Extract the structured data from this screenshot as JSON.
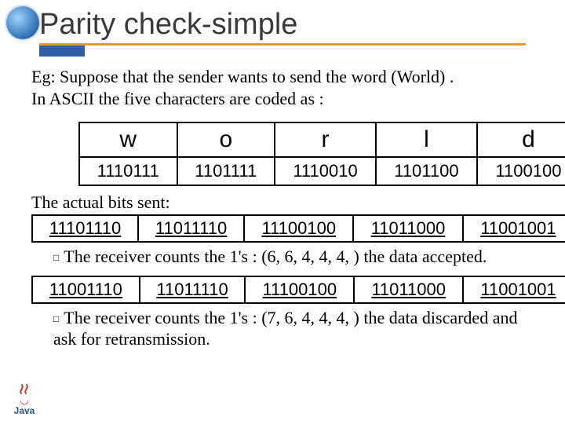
{
  "title": "Parity check-simple",
  "intro_line1": "Eg: Suppose that the sender wants to send the word (World) .",
  "intro_line2": "In ASCII the five characters are coded as :",
  "word_table": {
    "letters": [
      "w",
      "o",
      "r",
      "l",
      "d"
    ],
    "codes": [
      "1110111",
      "1101111",
      "1110010",
      "1101100",
      "1100100"
    ]
  },
  "actual_bits_label": "The actual bits sent:",
  "sent_bits": [
    "11101110",
    "11011110",
    "11100100",
    "11011000",
    "11001001"
  ],
  "bullet1": "The receiver counts the 1's : (6, 6, 4, 4, 4, ) the data accepted.",
  "recv_bits": [
    "11001110",
    "11011110",
    "11100100",
    "11011000",
    "11001001"
  ],
  "bullet2": "The receiver counts the 1's : (7, 6, 4, 4, 4, ) the data discarded and ask for retransmission.",
  "java_label": "Java"
}
